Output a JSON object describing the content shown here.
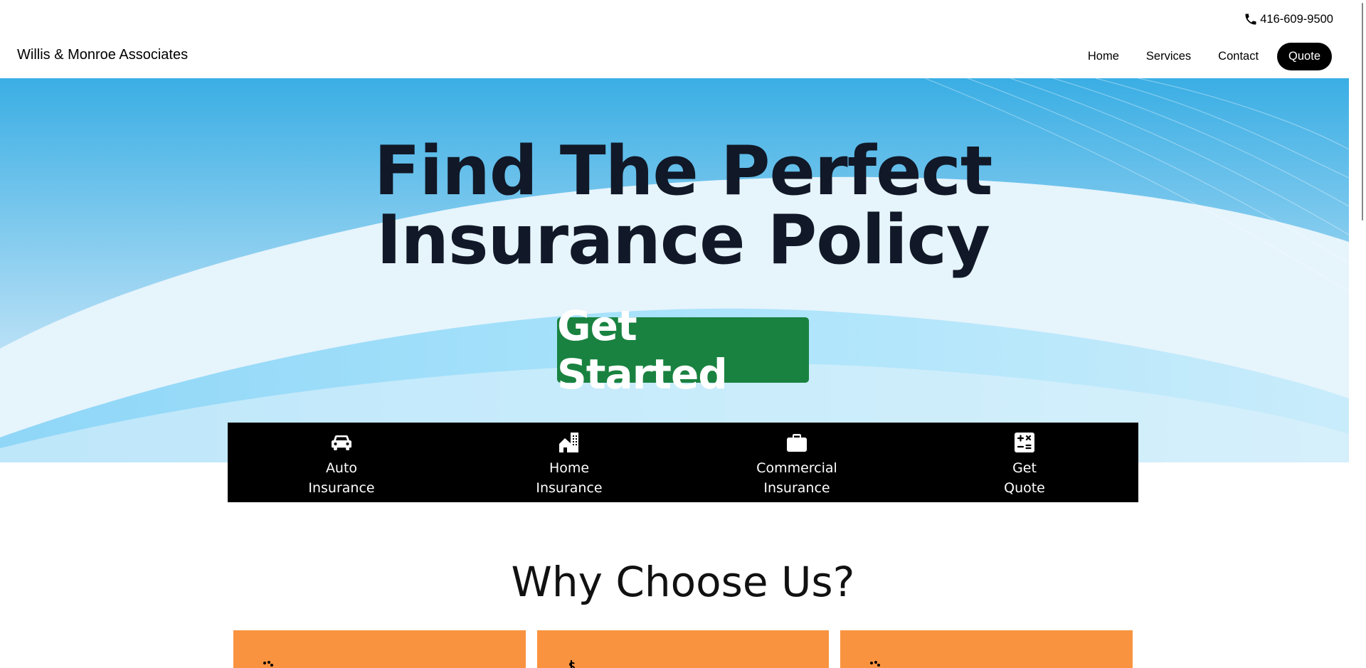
{
  "topbar": {
    "phone": "416-609-9500",
    "phone_icon": "phone-icon"
  },
  "navbar": {
    "brand": "Willis & Monroe Associates",
    "links": [
      "Home",
      "Services",
      "Contact"
    ],
    "quote": "Quote"
  },
  "hero": {
    "headline_line1": "Find The Perfect",
    "headline_line2": "Insurance Policy",
    "cta": "Get Started"
  },
  "services": [
    {
      "line1": "Auto",
      "line2": "Insurance",
      "icon": "car-icon"
    },
    {
      "line1": "Home",
      "line2": "Insurance",
      "icon": "house-building-icon"
    },
    {
      "line1": "Commercial",
      "line2": "Insurance",
      "icon": "briefcase-icon"
    },
    {
      "line1": "Get",
      "line2": "Quote",
      "icon": "calculator-icon"
    }
  ],
  "why": {
    "title": "Why Choose Us?"
  },
  "colors": {
    "cta_green": "#198240",
    "card_orange": "#f99340",
    "headline": "#111827",
    "hero_sky": "#3aaee4",
    "service_bar": "#000000"
  }
}
